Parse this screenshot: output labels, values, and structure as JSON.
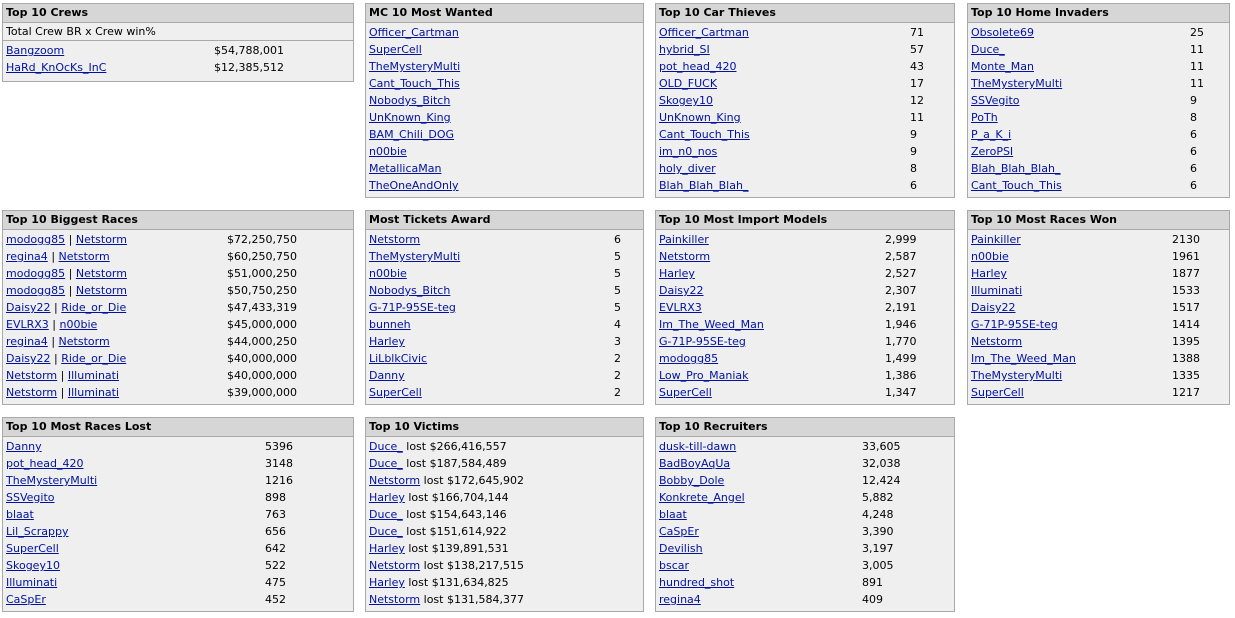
{
  "crews": {
    "title": "Top 10 Crews",
    "subtitle": "Total Crew BR x Crew win%",
    "rows": [
      {
        "name": "Bangzoom",
        "value": "$54,788,001"
      },
      {
        "name": "HaRd_KnOcKs_InC",
        "value": "$12,385,512"
      }
    ]
  },
  "most_wanted": {
    "title": "MC 10 Most Wanted",
    "rows": [
      {
        "name": "Officer_Cartman"
      },
      {
        "name": "SuperCell"
      },
      {
        "name": "TheMysteryMulti"
      },
      {
        "name": "Cant_Touch_This"
      },
      {
        "name": "Nobodys_Bitch"
      },
      {
        "name": "UnKnown_King"
      },
      {
        "name": "BAM_Chili_DOG"
      },
      {
        "name": "n00bie"
      },
      {
        "name": "MetallicaMan"
      },
      {
        "name": "TheOneAndOnly"
      }
    ]
  },
  "car_thieves": {
    "title": "Top 10 Car Thieves",
    "rows": [
      {
        "name": "Officer_Cartman",
        "value": "71"
      },
      {
        "name": "hybrid_SI",
        "value": "57"
      },
      {
        "name": "pot_head_420",
        "value": "43"
      },
      {
        "name": "OLD_FUCK",
        "value": "17"
      },
      {
        "name": "Skogey10",
        "value": "12"
      },
      {
        "name": "UnKnown_King",
        "value": "11"
      },
      {
        "name": "Cant_Touch_This",
        "value": "9"
      },
      {
        "name": "im_n0_nos",
        "value": "9"
      },
      {
        "name": "holy_diver",
        "value": "8"
      },
      {
        "name": "Blah_Blah_Blah_",
        "value": "6"
      }
    ]
  },
  "home_invaders": {
    "title": "Top 10 Home Invaders",
    "rows": [
      {
        "name": "Obsolete69",
        "value": "25"
      },
      {
        "name": "Duce_",
        "value": "11"
      },
      {
        "name": "Monte_Man",
        "value": "11"
      },
      {
        "name": "TheMysteryMulti",
        "value": "11"
      },
      {
        "name": "SSVegito",
        "value": "9"
      },
      {
        "name": "PoTh",
        "value": "8"
      },
      {
        "name": "P_a_K_i",
        "value": "6"
      },
      {
        "name": "ZeroPSI",
        "value": "6"
      },
      {
        "name": "Blah_Blah_Blah_",
        "value": "6"
      },
      {
        "name": "Cant_Touch_This",
        "value": "6"
      }
    ]
  },
  "biggest_races": {
    "title": "Top 10 Biggest Races",
    "separator": "|",
    "rows": [
      {
        "a": "modogg85",
        "b": "Netstorm",
        "value": "$72,250,750"
      },
      {
        "a": "regina4",
        "b": "Netstorm",
        "value": "$60,250,750"
      },
      {
        "a": "modogg85",
        "b": "Netstorm",
        "value": "$51,000,250"
      },
      {
        "a": "modogg85",
        "b": "Netstorm",
        "value": "$50,750,250"
      },
      {
        "a": "Daisy22",
        "b": "Ride_or_Die",
        "value": "$47,433,319"
      },
      {
        "a": "EVLRX3",
        "b": "n00bie",
        "value": "$45,000,000"
      },
      {
        "a": "regina4",
        "b": "Netstorm",
        "value": "$44,000,250"
      },
      {
        "a": "Daisy22",
        "b": "Ride_or_Die",
        "value": "$40,000,000"
      },
      {
        "a": "Netstorm",
        "b": "Illuminati",
        "value": "$40,000,000"
      },
      {
        "a": "Netstorm",
        "b": "Illuminati",
        "value": "$39,000,000"
      }
    ]
  },
  "tickets": {
    "title": "Most Tickets Award",
    "rows": [
      {
        "name": "Netstorm",
        "value": "6"
      },
      {
        "name": "TheMysteryMulti",
        "value": "5"
      },
      {
        "name": "n00bie",
        "value": "5"
      },
      {
        "name": "Nobodys_Bitch",
        "value": "5"
      },
      {
        "name": "G-71P-95SE-teg",
        "value": "5"
      },
      {
        "name": "bunneh",
        "value": "4"
      },
      {
        "name": "Harley",
        "value": "3"
      },
      {
        "name": "LiLblkCivic",
        "value": "2"
      },
      {
        "name": "Danny",
        "value": "2"
      },
      {
        "name": "SuperCell",
        "value": "2"
      }
    ]
  },
  "import_models": {
    "title": "Top 10 Most Import Models",
    "rows": [
      {
        "name": "Painkiller",
        "value": "2,999"
      },
      {
        "name": "Netstorm",
        "value": "2,587"
      },
      {
        "name": "Harley",
        "value": "2,527"
      },
      {
        "name": "Daisy22",
        "value": "2,307"
      },
      {
        "name": "EVLRX3",
        "value": "2,191"
      },
      {
        "name": "Im_The_Weed_Man",
        "value": "1,946"
      },
      {
        "name": "G-71P-95SE-teg",
        "value": "1,770"
      },
      {
        "name": "modogg85",
        "value": "1,499"
      },
      {
        "name": "Low_Pro_Maniak",
        "value": "1,386"
      },
      {
        "name": "SuperCell",
        "value": "1,347"
      }
    ]
  },
  "races_won": {
    "title": "Top 10 Most Races Won",
    "rows": [
      {
        "name": "Painkiller",
        "value": "2130"
      },
      {
        "name": "n00bie",
        "value": "1961"
      },
      {
        "name": "Harley",
        "value": "1877"
      },
      {
        "name": "Illuminati",
        "value": "1533"
      },
      {
        "name": "Daisy22",
        "value": "1517"
      },
      {
        "name": "G-71P-95SE-teg",
        "value": "1414"
      },
      {
        "name": "Netstorm",
        "value": "1395"
      },
      {
        "name": "Im_The_Weed_Man",
        "value": "1388"
      },
      {
        "name": "TheMysteryMulti",
        "value": "1335"
      },
      {
        "name": "SuperCell",
        "value": "1217"
      }
    ]
  },
  "races_lost": {
    "title": "Top 10 Most Races Lost",
    "rows": [
      {
        "name": "Danny",
        "value": "5396"
      },
      {
        "name": "pot_head_420",
        "value": "3148"
      },
      {
        "name": "TheMysteryMulti",
        "value": "1216"
      },
      {
        "name": "SSVegito",
        "value": "898"
      },
      {
        "name": "blaat",
        "value": "763"
      },
      {
        "name": "Lil_Scrappy",
        "value": "656"
      },
      {
        "name": "SuperCell",
        "value": "642"
      },
      {
        "name": "Skogey10",
        "value": "522"
      },
      {
        "name": "Illuminati",
        "value": "475"
      },
      {
        "name": "CaSpEr",
        "value": "452"
      }
    ]
  },
  "victims": {
    "title": "Top 10 Victims",
    "rows": [
      {
        "name": "Duce_",
        "text": "lost $266,416,557"
      },
      {
        "name": "Duce_",
        "text": "lost $187,584,489"
      },
      {
        "name": "Netstorm",
        "text": "lost $172,645,902"
      },
      {
        "name": "Harley",
        "text": "lost $166,704,144"
      },
      {
        "name": "Duce_",
        "text": "lost $154,643,146"
      },
      {
        "name": "Duce_",
        "text": "lost $151,614,922"
      },
      {
        "name": "Harley",
        "text": "lost $139,891,531"
      },
      {
        "name": "Netstorm",
        "text": "lost $138,217,515"
      },
      {
        "name": "Harley",
        "text": "lost $131,634,825"
      },
      {
        "name": "Netstorm",
        "text": "lost $131,584,377"
      }
    ]
  },
  "recruiters": {
    "title": "Top 10 Recruiters",
    "rows": [
      {
        "name": "dusk-till-dawn",
        "value": "33,605"
      },
      {
        "name": "BadBoyAqUa",
        "value": "32,038"
      },
      {
        "name": "Bobby_Dole",
        "value": "12,424"
      },
      {
        "name": "Konkrete_Angel",
        "value": "5,882"
      },
      {
        "name": "blaat",
        "value": "4,248"
      },
      {
        "name": "CaSpEr",
        "value": "3,390"
      },
      {
        "name": "Devilish",
        "value": "3,197"
      },
      {
        "name": "bscar",
        "value": "3,005"
      },
      {
        "name": "hundred_shot",
        "value": "891"
      },
      {
        "name": "regina4",
        "value": "409"
      }
    ]
  }
}
